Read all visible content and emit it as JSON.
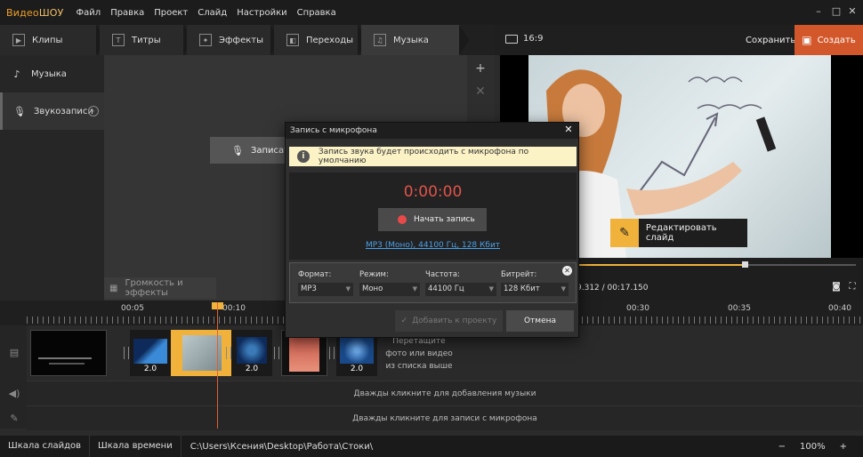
{
  "app": {
    "logo_a": "Видео",
    "logo_b": "ШОУ"
  },
  "menu": [
    "Файл",
    "Правка",
    "Проект",
    "Слайд",
    "Настройки",
    "Справка"
  ],
  "tabs": [
    {
      "label": "Клипы",
      "icon": "play-icon"
    },
    {
      "label": "Титры",
      "icon": "text-icon"
    },
    {
      "label": "Эффекты",
      "icon": "wand-icon"
    },
    {
      "label": "Переходы",
      "icon": "transition-icon"
    },
    {
      "label": "Музыка",
      "icon": "music-note-icon"
    }
  ],
  "header": {
    "aspect": "16:9",
    "save": "Сохранить",
    "create": "Создать"
  },
  "sidebar": {
    "items": [
      {
        "label": "Музыка",
        "icon": "music-icon"
      },
      {
        "label": "Звукозаписи",
        "icon": "microphone-icon"
      }
    ]
  },
  "content": {
    "record_btn": "Записать",
    "volume_btn": "Громкость и эффекты"
  },
  "preview": {
    "edit_slide": "Редактировать слайд",
    "timecode": "9.312 / 00:17.150",
    "progress": 0.6
  },
  "timeline": {
    "ticks": [
      "00:05",
      "00:10",
      "00:30",
      "00:35",
      "00:40"
    ],
    "transitions": [
      "2.0",
      "2.0",
      "2.0",
      "2.0"
    ],
    "drop_hint": "Перетащите фото или видео из списка выше",
    "music_hint": "Дважды кликните для добавления музыки",
    "mic_hint": "Дважды кликните для записи с микрофона"
  },
  "statusbar": {
    "tab1": "Шкала слайдов",
    "tab2": "Шкала времени",
    "path": "C:\\Users\\Ксения\\Desktop\\Работа\\Стоки\\",
    "zoom_minus": "−",
    "zoom": "100%",
    "zoom_plus": "+"
  },
  "dialog": {
    "title": "Запись с микрофона",
    "notice": "Запись звука будет происходить с микрофона по умолчанию",
    "timer": "0:00:00",
    "start": "Начать запись",
    "format_link": "MP3 (Моно), 44100 Гц, 128 Кбит",
    "settings": {
      "format_label": "Формат:",
      "format_value": "MP3",
      "mode_label": "Режим:",
      "mode_value": "Моно",
      "rate_label": "Частота:",
      "rate_value": "44100 Гц",
      "bitrate_label": "Битрейт:",
      "bitrate_value": "128 Кбит"
    },
    "add": "Добавить к проекту",
    "cancel": "Отмена"
  },
  "colors": {
    "accent": "#f0b23a",
    "create_bg": "#d2572a",
    "timer": "#e0544a",
    "link": "#4aa0e8"
  }
}
